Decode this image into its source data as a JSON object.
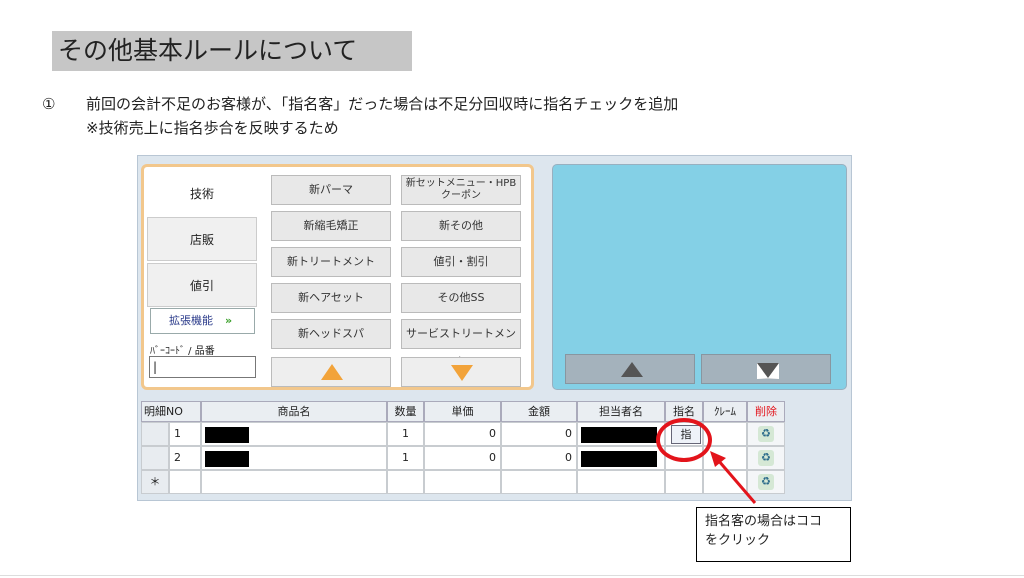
{
  "slide": {
    "title": "その他基本ルールについて",
    "note_num": "①",
    "note_line1": "前回の会計不足のお客様が、「指名客」だった場合は不足分回収時に指名チェックを追加",
    "note_line2": "※技術売上に指名歩合を反映するため"
  },
  "categories": [
    {
      "label": "技術"
    },
    {
      "label": "店販"
    },
    {
      "label": "値引"
    }
  ],
  "extend_button": {
    "label": "拡張機能",
    "arrow": "»"
  },
  "barcode": {
    "label": "ﾊﾞｰｺｰﾄﾞ / 品番",
    "value": ""
  },
  "menu_col1": [
    "新パーマ",
    "新縮毛矯正",
    "新トリートメント",
    "新ヘアセット",
    "新ヘッドスパ"
  ],
  "menu_col2": [
    "新セットメニュー・HPBクーポン",
    "新その他",
    "値引・割引",
    "その他SS",
    "サービストリートメント"
  ],
  "table": {
    "headers": [
      "明細NO",
      "商品名",
      "数量",
      "単価",
      "金額",
      "担当者名",
      "指名",
      "ｸﾚｰﾑ",
      "削除"
    ],
    "rows": [
      {
        "no": "1",
        "qty": "1",
        "price": "0",
        "amount": "0",
        "shimei": "指"
      },
      {
        "no": "2",
        "qty": "1",
        "price": "0",
        "amount": "0",
        "shimei": ""
      }
    ],
    "new_row_marker": "＊"
  },
  "callout": {
    "line1": "指名客の場合はココ",
    "line2": "をクリック"
  },
  "colors": {
    "accent_red": "#e3141b",
    "panel_blue": "#84d0e6",
    "arrow_orange": "#f2a33a"
  }
}
